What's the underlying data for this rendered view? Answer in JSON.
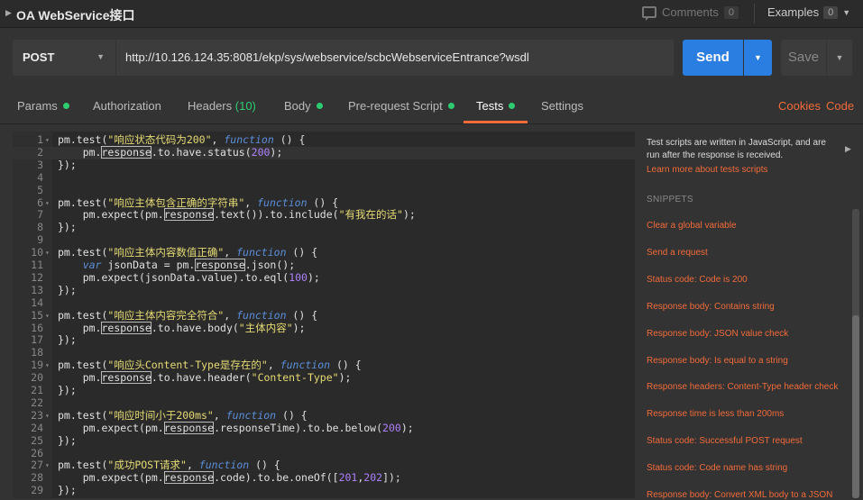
{
  "topbar": {
    "title": "OA WebService接口",
    "comments_label": "Comments",
    "comments_count": "0",
    "examples_label": "Examples",
    "examples_count": "0"
  },
  "request": {
    "method": "POST",
    "url": "http://10.126.124.35:8081/ekp/sys/webservice/scbcWebserviceEntrance?wsdl",
    "send_label": "Send",
    "save_label": "Save"
  },
  "tabs": [
    {
      "label": "Params",
      "dot": true
    },
    {
      "label": "Authorization"
    },
    {
      "label": "Headers",
      "count": "(10)"
    },
    {
      "label": "Body",
      "dot": true
    },
    {
      "label": "Pre-request Script",
      "dot": true
    },
    {
      "label": "Tests",
      "dot": true,
      "active": true
    },
    {
      "label": "Settings"
    }
  ],
  "links": {
    "cookies": "Cookies",
    "code": "Code"
  },
  "panel": {
    "description": "Test scripts are written in JavaScript, and are run after the response is received.",
    "learn_more": "Learn more about tests scripts",
    "snippets_heading": "SNIPPETS",
    "snippets": [
      "Clear a global variable",
      "Send a request",
      "Status code: Code is 200",
      "Response body: Contains string",
      "Response body: JSON value check",
      "Response body: Is equal to a string",
      "Response headers: Content-Type header check",
      "Response time is less than 200ms",
      "Status code: Successful POST request",
      "Status code: Code name has string",
      "Response body: Convert XML body to a JSON"
    ]
  },
  "colors": {
    "accent": "#f26b3a",
    "send": "#2a7de1",
    "status_dot": "#2ecc71"
  },
  "editor": {
    "lines": [
      {
        "n": "1",
        "fold": true,
        "code": [
          [
            "pm.test(",
            ""
          ],
          [
            "\"响应状态代码为200\"",
            "str"
          ],
          [
            ", ",
            ""
          ],
          [
            "function",
            "kw"
          ],
          [
            " () {",
            ""
          ]
        ]
      },
      {
        "n": "2",
        "cursor": true,
        "code": [
          [
            "    pm.",
            ""
          ],
          [
            "response",
            "box"
          ],
          [
            ".to.have.status(",
            ""
          ],
          [
            "200",
            "num"
          ],
          [
            ");",
            ""
          ]
        ]
      },
      {
        "n": "3",
        "code": [
          [
            "});",
            ""
          ]
        ]
      },
      {
        "n": "4",
        "code": []
      },
      {
        "n": "5",
        "code": []
      },
      {
        "n": "6",
        "fold": true,
        "code": [
          [
            "pm.test(",
            ""
          ],
          [
            "\"响应主体包含正确的字符串\"",
            "str"
          ],
          [
            ", ",
            ""
          ],
          [
            "function",
            "kw"
          ],
          [
            " () {",
            ""
          ]
        ]
      },
      {
        "n": "7",
        "code": [
          [
            "    pm.expect(pm.",
            ""
          ],
          [
            "response",
            "box"
          ],
          [
            ".text()).to.include(",
            ""
          ],
          [
            "\"有我在的话\"",
            "str"
          ],
          [
            ");",
            ""
          ]
        ]
      },
      {
        "n": "8",
        "code": [
          [
            "});",
            ""
          ]
        ]
      },
      {
        "n": "9",
        "code": []
      },
      {
        "n": "10",
        "fold": true,
        "code": [
          [
            "pm.test(",
            ""
          ],
          [
            "\"响应主体内容数值正确\"",
            "str"
          ],
          [
            ", ",
            ""
          ],
          [
            "function",
            "kw"
          ],
          [
            " () {",
            ""
          ]
        ]
      },
      {
        "n": "11",
        "code": [
          [
            "    ",
            ""
          ],
          [
            "var",
            "kw"
          ],
          [
            " jsonData = pm.",
            ""
          ],
          [
            "response",
            "box"
          ],
          [
            ".json();",
            ""
          ]
        ]
      },
      {
        "n": "12",
        "code": [
          [
            "    pm.expect(jsonData.value).to.eql(",
            ""
          ],
          [
            "100",
            "num"
          ],
          [
            ");",
            ""
          ]
        ]
      },
      {
        "n": "13",
        "code": [
          [
            "});",
            ""
          ]
        ]
      },
      {
        "n": "14",
        "code": []
      },
      {
        "n": "15",
        "fold": true,
        "code": [
          [
            "pm.test(",
            ""
          ],
          [
            "\"响应主体内容完全符合\"",
            "str"
          ],
          [
            ", ",
            ""
          ],
          [
            "function",
            "kw"
          ],
          [
            " () {",
            ""
          ]
        ]
      },
      {
        "n": "16",
        "code": [
          [
            "    pm.",
            ""
          ],
          [
            "response",
            "box"
          ],
          [
            ".to.have.body(",
            ""
          ],
          [
            "\"主体内容\"",
            "str"
          ],
          [
            ");",
            ""
          ]
        ]
      },
      {
        "n": "17",
        "code": [
          [
            "});",
            ""
          ]
        ]
      },
      {
        "n": "18",
        "code": []
      },
      {
        "n": "19",
        "fold": true,
        "code": [
          [
            "pm.test(",
            ""
          ],
          [
            "\"响应头Content-Type是存在的\"",
            "str"
          ],
          [
            ", ",
            ""
          ],
          [
            "function",
            "kw"
          ],
          [
            " () {",
            ""
          ]
        ]
      },
      {
        "n": "20",
        "code": [
          [
            "    pm.",
            ""
          ],
          [
            "response",
            "box"
          ],
          [
            ".to.have.header(",
            ""
          ],
          [
            "\"Content-Type\"",
            "str"
          ],
          [
            ");",
            ""
          ]
        ]
      },
      {
        "n": "21",
        "code": [
          [
            "});",
            ""
          ]
        ]
      },
      {
        "n": "22",
        "code": []
      },
      {
        "n": "23",
        "fold": true,
        "code": [
          [
            "pm.test(",
            ""
          ],
          [
            "\"响应时间小于200ms\"",
            "str"
          ],
          [
            ", ",
            ""
          ],
          [
            "function",
            "kw"
          ],
          [
            " () {",
            ""
          ]
        ]
      },
      {
        "n": "24",
        "code": [
          [
            "    pm.expect(pm.",
            ""
          ],
          [
            "response",
            "box"
          ],
          [
            ".responseTime).to.be.below(",
            ""
          ],
          [
            "200",
            "num"
          ],
          [
            ");",
            ""
          ]
        ]
      },
      {
        "n": "25",
        "code": [
          [
            "});",
            ""
          ]
        ]
      },
      {
        "n": "26",
        "code": []
      },
      {
        "n": "27",
        "fold": true,
        "code": [
          [
            "pm.test(",
            ""
          ],
          [
            "\"成功POST请求\"",
            "str"
          ],
          [
            ", ",
            ""
          ],
          [
            "function",
            "kw"
          ],
          [
            " () {",
            ""
          ]
        ]
      },
      {
        "n": "28",
        "code": [
          [
            "    pm.expect(pm.",
            ""
          ],
          [
            "response",
            "box"
          ],
          [
            ".code).to.be.oneOf([",
            ""
          ],
          [
            "201",
            "num"
          ],
          [
            ",",
            ""
          ],
          [
            "202",
            "num"
          ],
          [
            "]);",
            ""
          ]
        ]
      },
      {
        "n": "29",
        "code": [
          [
            "});",
            ""
          ]
        ]
      }
    ]
  }
}
